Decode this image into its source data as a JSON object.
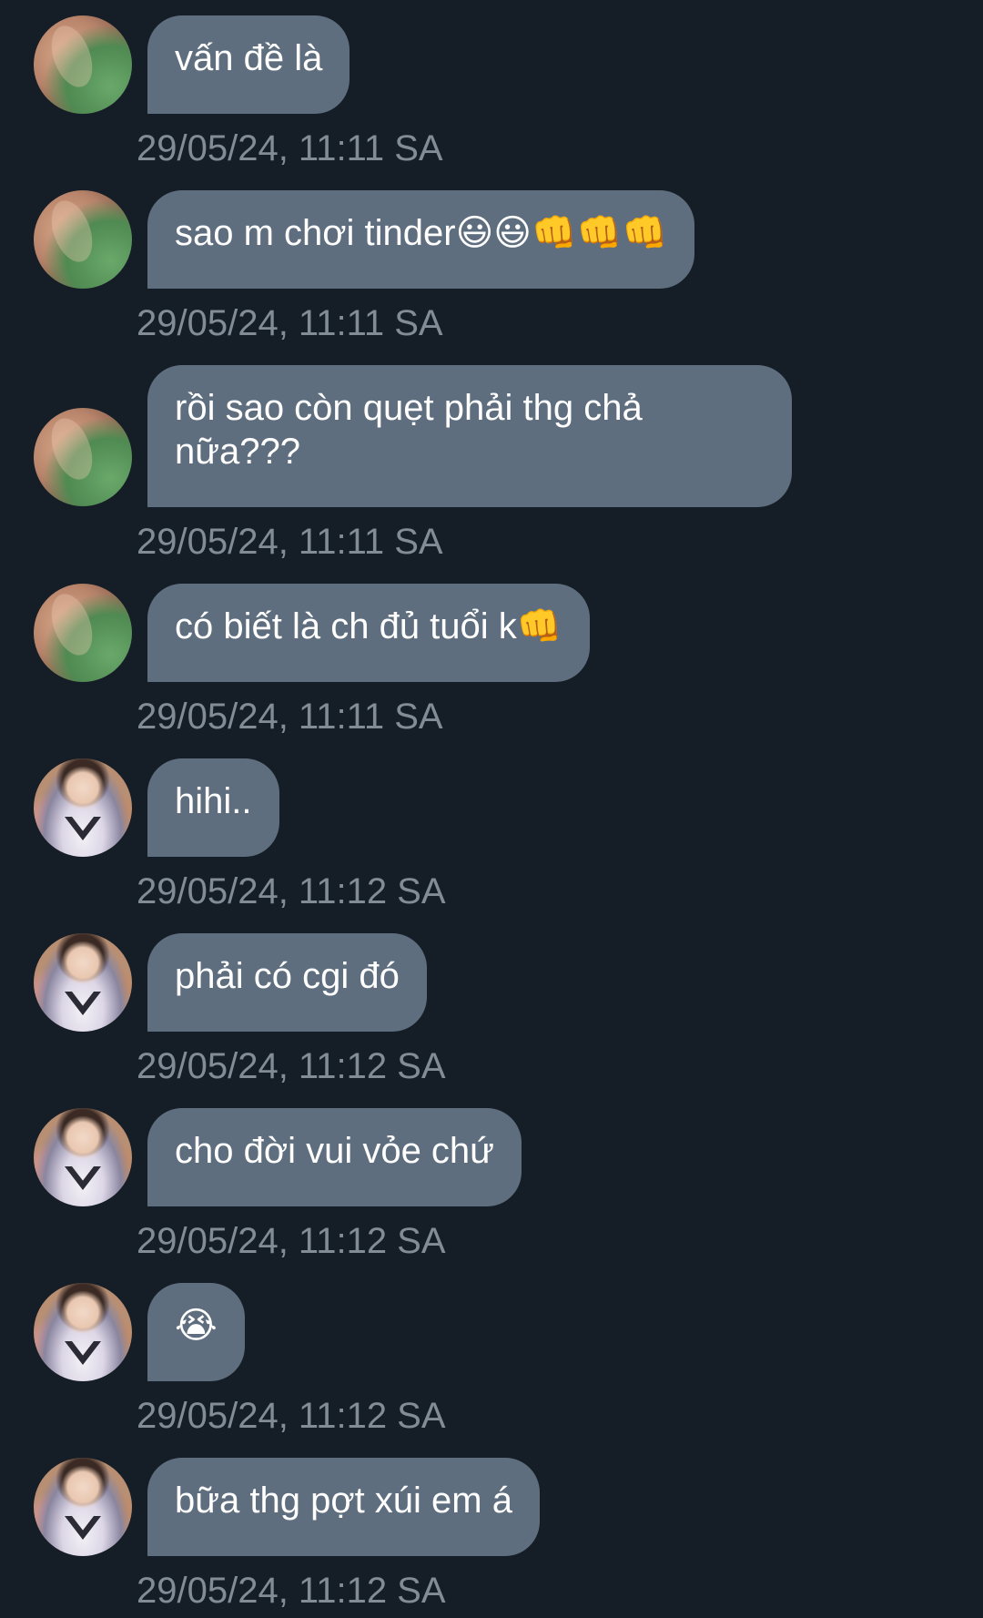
{
  "messages": [
    {
      "sender": "a",
      "text": "vấn đề là",
      "time": "29/05/24, 11:11 SA"
    },
    {
      "sender": "a",
      "text": "sao m chơi tinder😃😃👊👊👊",
      "time": "29/05/24, 11:11 SA"
    },
    {
      "sender": "a",
      "text": "rồi sao còn quẹt phải thg chả\nnữa???",
      "time": "29/05/24, 11:11 SA"
    },
    {
      "sender": "a",
      "text": "có biết là ch đủ tuổi k👊",
      "time": "29/05/24, 11:11 SA"
    },
    {
      "sender": "b",
      "text": "hihi..",
      "time": "29/05/24, 11:12 SA"
    },
    {
      "sender": "b",
      "text": "phải có cgi đó",
      "time": "29/05/24, 11:12 SA"
    },
    {
      "sender": "b",
      "text": "cho đời vui vỏe chứ",
      "time": "29/05/24, 11:12 SA"
    },
    {
      "sender": "b",
      "text": "😭",
      "time": "29/05/24, 11:12 SA"
    },
    {
      "sender": "b",
      "text": "bữa thg pợt xúi em á",
      "time": "29/05/24, 11:12 SA"
    }
  ],
  "colors": {
    "background": "#151e27",
    "bubble": "#5e6e7e",
    "bubble_text": "#ffffff",
    "timestamp": "#828c97"
  }
}
